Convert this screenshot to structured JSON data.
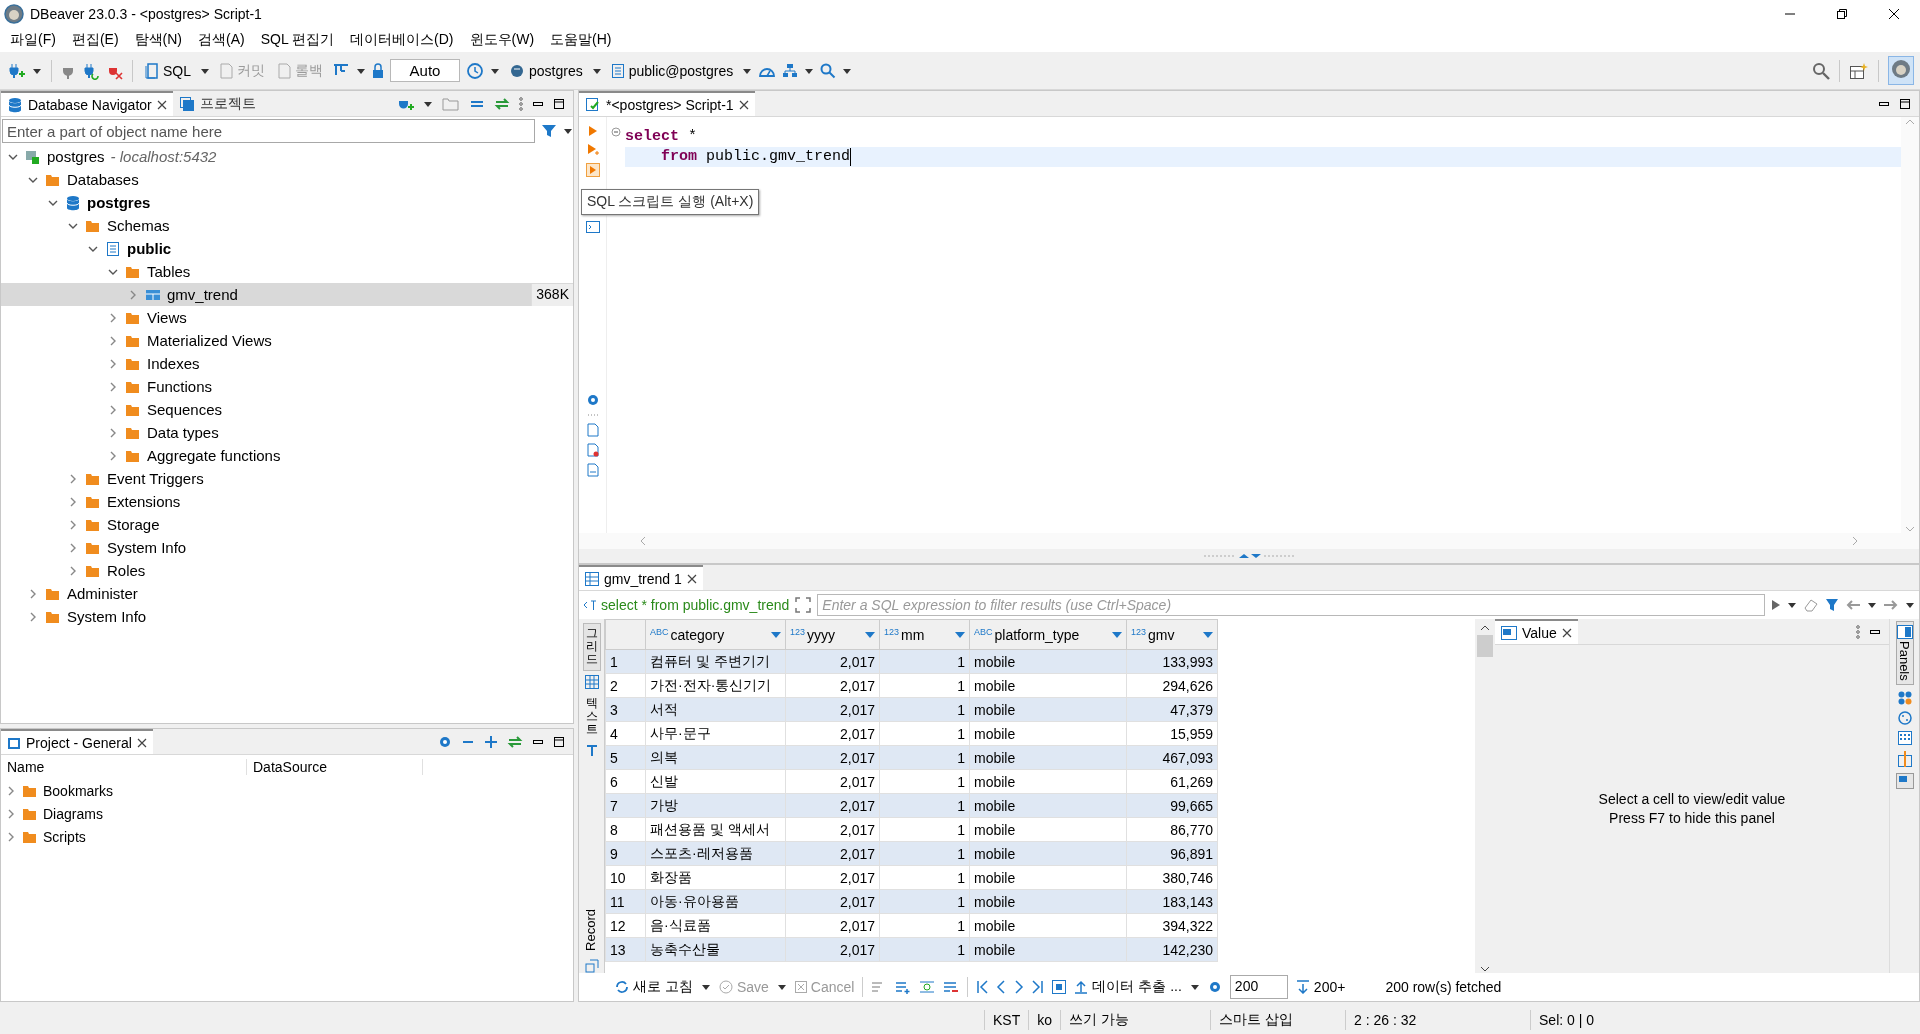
{
  "window": {
    "title": "DBeaver 23.0.3 - <postgres> Script-1"
  },
  "menu": [
    "파일(F)",
    "편집(E)",
    "탐색(N)",
    "검색(A)",
    "SQL 편집기",
    "데이터베이스(D)",
    "윈도우(W)",
    "도움말(H)"
  ],
  "toolbar": {
    "sql": {
      "label": "SQL"
    },
    "commit": {
      "label": "커밋",
      "disabled": true
    },
    "rollback": {
      "label": "롤백",
      "disabled": true
    },
    "transaction_mode": "Auto",
    "datasource": "postgres",
    "schema": "public@postgres"
  },
  "navigator": {
    "tabs": [
      {
        "label": "Database Navigator",
        "selected": true,
        "closable": true
      },
      {
        "label": "프로젝트",
        "selected": false,
        "closable": false
      }
    ],
    "filter": {
      "placeholder": "Enter a part of object name here"
    },
    "tree": [
      {
        "label": "postgres",
        "host": " - localhost:5432",
        "kind": "connection",
        "expanded": true,
        "active": false,
        "selected": false,
        "children": [
          {
            "label": "Databases",
            "kind": "folder",
            "expanded": true,
            "active": false,
            "selected": false,
            "children": [
              {
                "label": "postgres",
                "kind": "database",
                "expanded": true,
                "active": true,
                "selected": false,
                "children": [
                  {
                    "label": "Schemas",
                    "kind": "folder",
                    "expanded": true,
                    "active": false,
                    "selected": false,
                    "children": [
                      {
                        "label": "public",
                        "kind": "schema",
                        "expanded": true,
                        "active": true,
                        "selected": false,
                        "children": [
                          {
                            "label": "Tables",
                            "kind": "folder",
                            "expanded": true,
                            "active": false,
                            "selected": false,
                            "children": [
                              {
                                "label": "gmv_trend",
                                "kind": "table",
                                "expanded": false,
                                "active": false,
                                "selected": true,
                                "size": "368K"
                              }
                            ]
                          },
                          {
                            "label": "Views",
                            "kind": "folder",
                            "expanded": false,
                            "active": false,
                            "selected": false
                          },
                          {
                            "label": "Materialized Views",
                            "kind": "folder",
                            "expanded": false,
                            "active": false,
                            "selected": false
                          },
                          {
                            "label": "Indexes",
                            "kind": "folder",
                            "expanded": false,
                            "active": false,
                            "selected": false
                          },
                          {
                            "label": "Functions",
                            "kind": "folder",
                            "expanded": false,
                            "active": false,
                            "selected": false
                          },
                          {
                            "label": "Sequences",
                            "kind": "folder",
                            "expanded": false,
                            "active": false,
                            "selected": false
                          },
                          {
                            "label": "Data types",
                            "kind": "folder",
                            "expanded": false,
                            "active": false,
                            "selected": false
                          },
                          {
                            "label": "Aggregate functions",
                            "kind": "folder",
                            "expanded": false,
                            "active": false,
                            "selected": false
                          }
                        ]
                      }
                    ]
                  },
                  {
                    "label": "Event Triggers",
                    "kind": "folder",
                    "expanded": false,
                    "active": false,
                    "selected": false
                  },
                  {
                    "label": "Extensions",
                    "kind": "folder",
                    "expanded": false,
                    "active": false,
                    "selected": false
                  },
                  {
                    "label": "Storage",
                    "kind": "folder",
                    "expanded": false,
                    "active": false,
                    "selected": false
                  },
                  {
                    "label": "System Info",
                    "kind": "folder",
                    "expanded": false,
                    "active": false,
                    "selected": false
                  },
                  {
                    "label": "Roles",
                    "kind": "folder",
                    "expanded": false,
                    "active": false,
                    "selected": false
                  }
                ]
              }
            ]
          },
          {
            "label": "Administer",
            "kind": "folder",
            "expanded": false,
            "active": false,
            "selected": false
          },
          {
            "label": "System Info",
            "kind": "folder",
            "expanded": false,
            "active": false,
            "selected": false
          }
        ]
      }
    ]
  },
  "project": {
    "tab": {
      "label": "Project - General",
      "selected": true
    },
    "columns": [
      "Name",
      "DataSource"
    ],
    "items": [
      {
        "label": "Bookmarks",
        "expanded": false
      },
      {
        "label": "Diagrams",
        "expanded": false
      },
      {
        "label": "Scripts",
        "expanded": false
      }
    ]
  },
  "editor": {
    "tab": {
      "label": "*<postgres> Script-1",
      "selected": true
    },
    "lines": [
      {
        "current": false,
        "indented": false,
        "tokens": [
          {
            "text": "select",
            "kind": "keyword"
          },
          {
            "text": " *",
            "kind": "plain"
          }
        ]
      },
      {
        "current": true,
        "indented": true,
        "tokens": [
          {
            "text": "from",
            "kind": "keyword"
          },
          {
            "text": " public.gmv_trend",
            "kind": "plain"
          }
        ]
      }
    ],
    "tooltip": "SQL 스크립트 실행 (Alt+X)"
  },
  "results": {
    "tab": {
      "label": "gmv_trend 1",
      "selected": true
    },
    "query": "select * from public.gmv_trend",
    "filter": {
      "placeholder": "Enter a SQL expression to filter results (use Ctrl+Space)"
    },
    "side_tabs": [
      {
        "label": "그리드",
        "selected": true
      },
      {
        "label": "텍스트",
        "selected": false
      }
    ],
    "record_tab": "Record",
    "columns": [
      {
        "type": "ABC",
        "name": "category"
      },
      {
        "type": "123",
        "name": "yyyy"
      },
      {
        "type": "123",
        "name": "mm"
      },
      {
        "type": "ABC",
        "name": "platform_type"
      },
      {
        "type": "123",
        "name": "gmv"
      }
    ],
    "rows": [
      {
        "number": "1",
        "cells": [
          "컴퓨터 및 주변기기",
          "2,017",
          "1",
          "mobile",
          "133,993"
        ]
      },
      {
        "number": "2",
        "cells": [
          "가전·전자·통신기기",
          "2,017",
          "1",
          "mobile",
          "294,626"
        ]
      },
      {
        "number": "3",
        "cells": [
          "서적",
          "2,017",
          "1",
          "mobile",
          "47,379"
        ]
      },
      {
        "number": "4",
        "cells": [
          "사무·문구",
          "2,017",
          "1",
          "mobile",
          "15,959"
        ]
      },
      {
        "number": "5",
        "cells": [
          "의복",
          "2,017",
          "1",
          "mobile",
          "467,093"
        ]
      },
      {
        "number": "6",
        "cells": [
          "신발",
          "2,017",
          "1",
          "mobile",
          "61,269"
        ]
      },
      {
        "number": "7",
        "cells": [
          "가방",
          "2,017",
          "1",
          "mobile",
          "99,665"
        ]
      },
      {
        "number": "8",
        "cells": [
          "패션용품 및 액세서",
          "2,017",
          "1",
          "mobile",
          "86,770"
        ]
      },
      {
        "number": "9",
        "cells": [
          "스포츠·레저용품",
          "2,017",
          "1",
          "mobile",
          "96,891"
        ]
      },
      {
        "number": "10",
        "cells": [
          "화장품",
          "2,017",
          "1",
          "mobile",
          "380,746"
        ]
      },
      {
        "number": "11",
        "cells": [
          "아동·유아용품",
          "2,017",
          "1",
          "mobile",
          "183,143"
        ]
      },
      {
        "number": "12",
        "cells": [
          "음·식료품",
          "2,017",
          "1",
          "mobile",
          "394,322"
        ]
      },
      {
        "number": "13",
        "cells": [
          "농축수산물",
          "2,017",
          "1",
          "mobile",
          "142,230"
        ]
      }
    ],
    "value_panel": {
      "tab": {
        "label": "Value",
        "selected": true
      },
      "lines": [
        "Select a cell to view/edit value",
        "Press F7 to hide this panel"
      ]
    },
    "panels_tab": "Panels",
    "bottom": {
      "refresh": "새로 고침",
      "save": {
        "label": "Save",
        "disabled": true
      },
      "cancel": {
        "label": "Cancel",
        "disabled": true
      },
      "export": "데이터 추출 ...",
      "fetch_size": "200",
      "fetch_more": "200+",
      "fetched": "200 row(s) fetched"
    }
  },
  "status_bar": [
    "KST",
    "ko",
    "쓰기 가능",
    "스마트 삽입",
    "2 : 26 : 32",
    "Sel: 0 | 0"
  ]
}
